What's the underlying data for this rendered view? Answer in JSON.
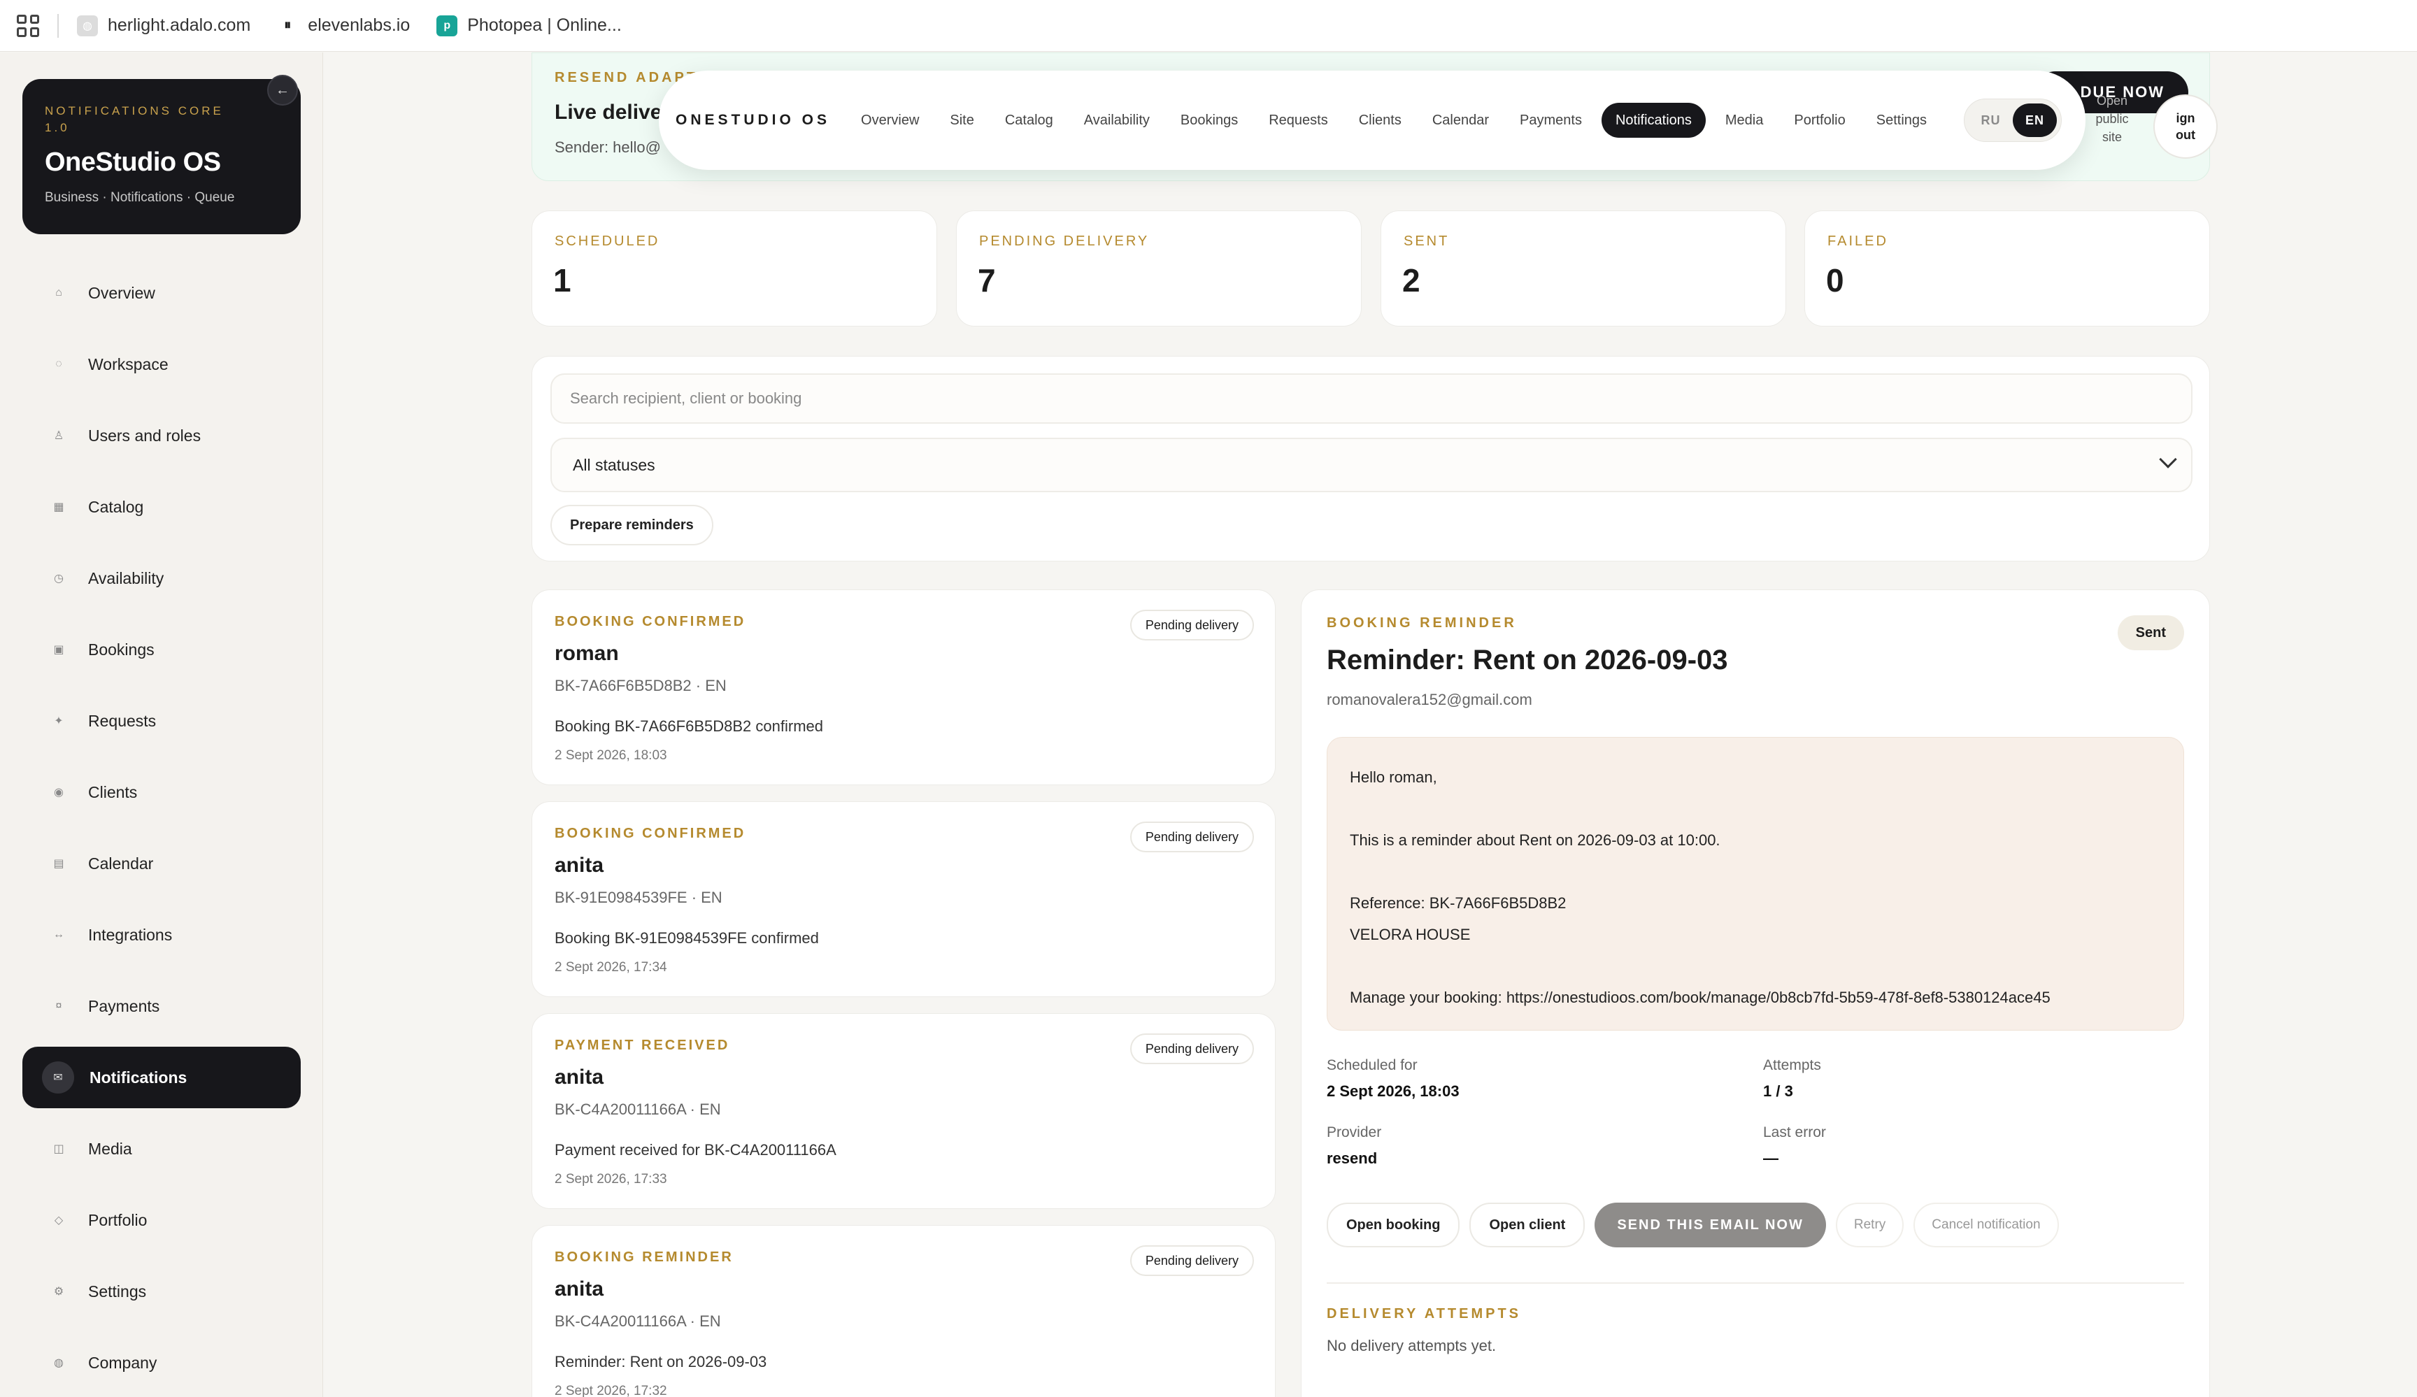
{
  "browser": {
    "bookmarks": [
      {
        "label": "herlight.adalo.com",
        "icon": "globe-icon"
      },
      {
        "label": "elevenlabs.io",
        "icon": "pause-icon"
      },
      {
        "label": "Photopea | Online...",
        "icon": "photopea-icon"
      }
    ]
  },
  "sidebar": {
    "brand_kicker": "NOTIFICATIONS CORE 1.0",
    "brand_title": "OneStudio OS",
    "brand_sub": "Business · Notifications · Queue",
    "items": [
      {
        "label": "Overview",
        "icon": "⌂"
      },
      {
        "label": "Workspace",
        "icon": "◌"
      },
      {
        "label": "Users and roles",
        "icon": "♙"
      },
      {
        "label": "Catalog",
        "icon": "▦"
      },
      {
        "label": "Availability",
        "icon": "◷"
      },
      {
        "label": "Bookings",
        "icon": "▣"
      },
      {
        "label": "Requests",
        "icon": "✦"
      },
      {
        "label": "Clients",
        "icon": "◉"
      },
      {
        "label": "Calendar",
        "icon": "▤"
      },
      {
        "label": "Integrations",
        "icon": "↔"
      },
      {
        "label": "Payments",
        "icon": "¤"
      },
      {
        "label": "Notifications",
        "icon": "✉"
      },
      {
        "label": "Media",
        "icon": "◫"
      },
      {
        "label": "Portfolio",
        "icon": "◇"
      },
      {
        "label": "Settings",
        "icon": "⚙"
      },
      {
        "label": "Company",
        "icon": "◍"
      }
    ],
    "active": "Notifications"
  },
  "hero": {
    "kicker": "RESEND ADAPT",
    "title": "Live delive",
    "sender": "Sender: hello@",
    "due_button": "D DUE NOW"
  },
  "topbar": {
    "brand": "ONESTUDIO OS",
    "items": [
      "Overview",
      "Site",
      "Catalog",
      "Availability",
      "Bookings",
      "Requests",
      "Clients",
      "Calendar",
      "Payments",
      "Notifications",
      "Media",
      "Portfolio",
      "Settings"
    ],
    "active": "Notifications",
    "lang": [
      "RU",
      "EN"
    ],
    "lang_active": "EN",
    "open_public_site": [
      "Open",
      "public",
      "site"
    ],
    "sign_out": [
      "ign",
      "out"
    ]
  },
  "stats": [
    {
      "label": "SCHEDULED",
      "value": "1"
    },
    {
      "label": "PENDING DELIVERY",
      "value": "7"
    },
    {
      "label": "SENT",
      "value": "2"
    },
    {
      "label": "FAILED",
      "value": "0"
    }
  ],
  "filters": {
    "search_placeholder": "Search recipient, client or booking",
    "status_selected": "All statuses",
    "prepare_button": "Prepare reminders"
  },
  "notifications": [
    {
      "kicker": "BOOKING CONFIRMED",
      "name": "roman",
      "ref": "BK-7A66F6B5D8B2 · EN",
      "message": "Booking BK-7A66F6B5D8B2 confirmed",
      "time": "2 Sept 2026, 18:03",
      "status": "Pending delivery"
    },
    {
      "kicker": "BOOKING CONFIRMED",
      "name": "anita",
      "ref": "BK-91E0984539FE · EN",
      "message": "Booking BK-91E0984539FE confirmed",
      "time": "2 Sept 2026, 17:34",
      "status": "Pending delivery"
    },
    {
      "kicker": "PAYMENT RECEIVED",
      "name": "anita",
      "ref": "BK-C4A20011166A · EN",
      "message": "Payment received for BK-C4A20011166A",
      "time": "2 Sept 2026, 17:33",
      "status": "Pending delivery"
    },
    {
      "kicker": "BOOKING REMINDER",
      "name": "anita",
      "ref": "BK-C4A20011166A · EN",
      "message": "Reminder: Rent on 2026-09-03",
      "time": "2 Sept 2026, 17:32",
      "status": "Pending delivery"
    }
  ],
  "detail": {
    "kicker": "BOOKING REMINDER",
    "status": "Sent",
    "title": "Reminder: Rent on 2026-09-03",
    "email": "romanovalera152@gmail.com",
    "message_lines": [
      "Hello roman,",
      "",
      "This is a reminder about Rent on 2026-09-03 at 10:00.",
      "",
      "Reference: BK-7A66F6B5D8B2",
      "VELORA HOUSE",
      "",
      "Manage your booking: https://onestudioos.com/book/manage/0b8cb7fd-5b59-478f-8ef8-5380124ace45"
    ],
    "scheduled_label": "Scheduled for",
    "scheduled_value": "2 Sept 2026, 18:03",
    "attempts_label": "Attempts",
    "attempts_value": "1 / 3",
    "provider_label": "Provider",
    "provider_value": "resend",
    "last_error_label": "Last error",
    "last_error_value": "—",
    "actions": {
      "open_booking": "Open booking",
      "open_client": "Open client",
      "send_now": "SEND THIS EMAIL NOW",
      "retry": "Retry",
      "cancel": "Cancel notification"
    },
    "attempts_kicker": "DELIVERY ATTEMPTS",
    "attempts_empty": "No delivery attempts yet."
  }
}
